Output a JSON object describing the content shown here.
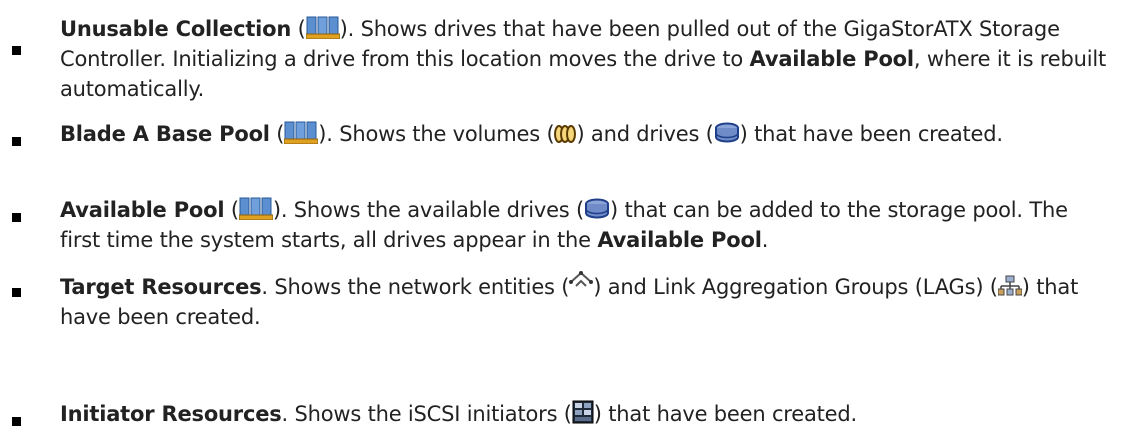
{
  "items": [
    {
      "title": "Unusable Collection",
      "icon": "pool-icon",
      "t1": "). Shows drives that have been pulled out of the GigaStorATX Storage Controller. Initializing a drive from this location moves the drive to ",
      "b1": "Available Pool",
      "t2": ", where it is rebuilt automatically."
    },
    {
      "title": "Blade A Base Pool",
      "icon": "pool-icon",
      "t1": "). Shows the volumes (",
      "icon2": "volume-icon",
      "t2": ") and drives (",
      "icon3": "drive-icon",
      "t3": ") that have been created."
    },
    {
      "title": "Available Pool",
      "icon": "pool-icon",
      "t1": "). Shows the available drives (",
      "icon2": "drive-icon",
      "t2": ") that can be added to the storage pool. The first time the system starts, all drives appear in the ",
      "b1": "Available Pool",
      "t3": "."
    },
    {
      "title": "Target Resources",
      "t1": ". Shows the network entities (",
      "icon2": "network-entity-icon",
      "t2": ") and Link Aggregation Groups (LAGs) (",
      "icon3": "lag-icon",
      "t3": ") that have been created."
    },
    {
      "title": "Initiator Resources",
      "t1": ". Shows the iSCSI initiators (",
      "icon2": "initiator-icon",
      "t2": ") that have been created."
    }
  ],
  "open_paren": " ("
}
